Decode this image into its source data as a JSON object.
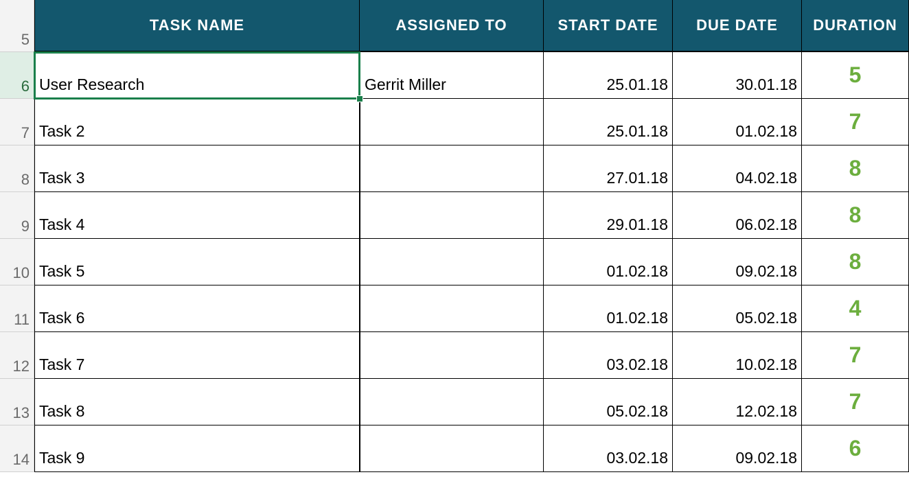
{
  "headers": {
    "task_name": "TASK NAME",
    "assigned_to": "ASSIGNED TO",
    "start_date": "START DATE",
    "due_date": "DUE DATE",
    "duration": "DURATION"
  },
  "row_numbers": [
    "5",
    "6",
    "7",
    "8",
    "9",
    "10",
    "11",
    "12",
    "13",
    "14"
  ],
  "active_row_index": 1,
  "selected_cell": {
    "row": 6,
    "col": "B"
  },
  "rows": [
    {
      "task": "User Research",
      "assigned": "Gerrit Miller",
      "start": "25.01.18",
      "due": "30.01.18",
      "duration": "5"
    },
    {
      "task": "Task 2",
      "assigned": "",
      "start": "25.01.18",
      "due": "01.02.18",
      "duration": "7"
    },
    {
      "task": "Task 3",
      "assigned": "",
      "start": "27.01.18",
      "due": "04.02.18",
      "duration": "8"
    },
    {
      "task": "Task 4",
      "assigned": "",
      "start": "29.01.18",
      "due": "06.02.18",
      "duration": "8"
    },
    {
      "task": "Task 5",
      "assigned": "",
      "start": "01.02.18",
      "due": "09.02.18",
      "duration": "8"
    },
    {
      "task": "Task 6",
      "assigned": "",
      "start": "01.02.18",
      "due": "05.02.18",
      "duration": "4"
    },
    {
      "task": "Task 7",
      "assigned": "",
      "start": "03.02.18",
      "due": "10.02.18",
      "duration": "7"
    },
    {
      "task": "Task 8",
      "assigned": "",
      "start": "05.02.18",
      "due": "12.02.18",
      "duration": "7"
    },
    {
      "task": "Task 9",
      "assigned": "",
      "start": "03.02.18",
      "due": "09.02.18",
      "duration": "6"
    }
  ],
  "colors": {
    "header_bg": "#13576d",
    "duration_fg": "#6cae3e",
    "selection": "#1a7f4b"
  }
}
